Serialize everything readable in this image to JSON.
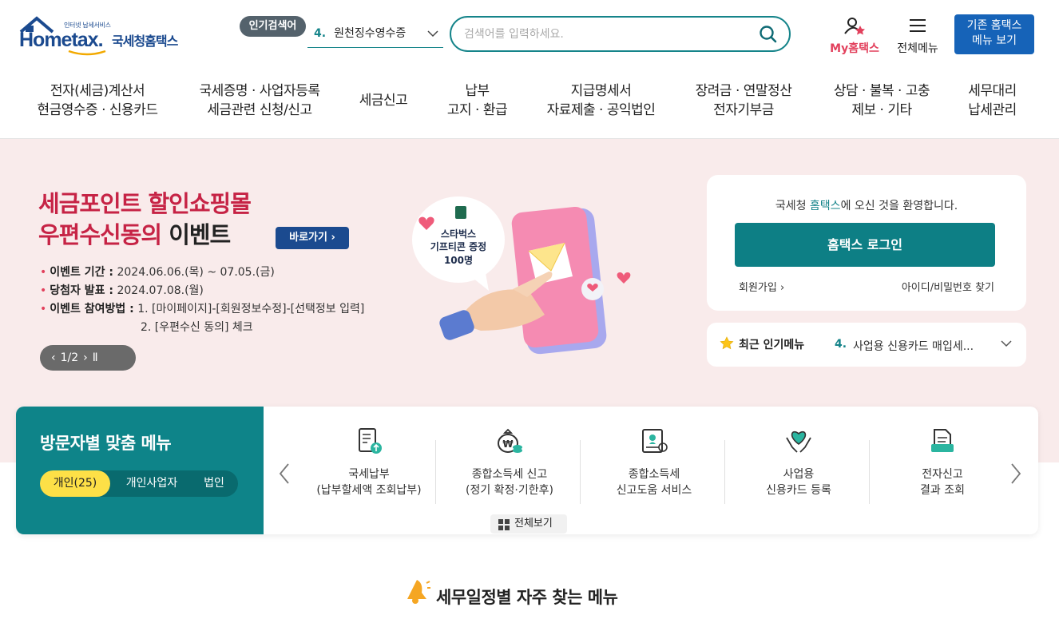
{
  "header": {
    "logo_small": "인터넷 납세서비스",
    "logo_brand": "Hometax.",
    "logo_kr": "국세청홈택스",
    "popular_badge": "인기검색어",
    "popular_num": "4.",
    "popular_text": "원천징수영수증",
    "search_placeholder": "검색어를 입력하세요.",
    "my_hometax": "My홈택스",
    "all_menu": "전체메뉴",
    "old_menu_line1": "기존 홈택스",
    "old_menu_line2": "메뉴 보기"
  },
  "gnb": [
    {
      "l1": "전자(세금)계산서",
      "l2": "현금영수증 · 신용카드"
    },
    {
      "l1": "국세증명 · 사업자등록",
      "l2": "세금관련 신청/신고"
    },
    {
      "l1": "세금신고",
      "l2": ""
    },
    {
      "l1": "납부",
      "l2": "고지 · 환급"
    },
    {
      "l1": "지급명세서",
      "l2": "자료제출 · 공익법인"
    },
    {
      "l1": "장려금 · 연말정산",
      "l2": "전자기부금"
    },
    {
      "l1": "상담 · 불복 · 고충",
      "l2": "제보 · 기타"
    },
    {
      "l1": "세무대리",
      "l2": "납세관리"
    }
  ],
  "banner": {
    "title_line1": "세금포인트 할인쇼핑몰",
    "title_line2_red": "우편수신동의",
    "title_line2_black": " 이벤트",
    "go_button": "바로가기",
    "details": [
      {
        "label": "이벤트 기간 :",
        "value": "2024.06.06.(목) ~ 07.05.(금)"
      },
      {
        "label": "당첨자 발표 :",
        "value": "2024.07.08.(월)"
      },
      {
        "label": "이벤트 참여방법 :",
        "value": "1. [마이페이지]-[회원정보수정]-[선택정보 입력]"
      }
    ],
    "detail_cont": "2. [우편수신 동의] 체크",
    "bubble_line1": "스타벅스",
    "bubble_line2": "기프티콘 증정",
    "bubble_line3": "100명",
    "pager": "1/2"
  },
  "login": {
    "welcome_pre": "국세청 ",
    "welcome_hl": "홈택스",
    "welcome_post": "에 오신 것을 환영합니다.",
    "button": "홈택스 로그인",
    "join": "회원가입",
    "find": "아이디/비밀번호 찾기"
  },
  "recent": {
    "title": "최근 인기메뉴",
    "num": "4.",
    "text": "사업용 신용카드 매입세..."
  },
  "visitor": {
    "title": "방문자별 맞춤 메뉴",
    "tabs": [
      "개인(25)",
      "개인사업자",
      "법인"
    ],
    "items": [
      {
        "l1": "국세납부",
        "l2": "(납부할세액 조회납부)"
      },
      {
        "l1": "종합소득세 신고",
        "l2": "(정기 확정·기한후)"
      },
      {
        "l1": "종합소득세",
        "l2": "신고도움 서비스"
      },
      {
        "l1": "사업용",
        "l2": "신용카드 등록"
      },
      {
        "l1": "전자신고",
        "l2": "결과 조회"
      }
    ],
    "view_all": "전체보기"
  },
  "schedule_title": "세무일정별 자주 찾는 메뉴",
  "colors": {
    "teal": "#0e8489",
    "blue": "#1b4a8f",
    "pink_bg": "#f9ebeb",
    "red": "#c62345"
  }
}
